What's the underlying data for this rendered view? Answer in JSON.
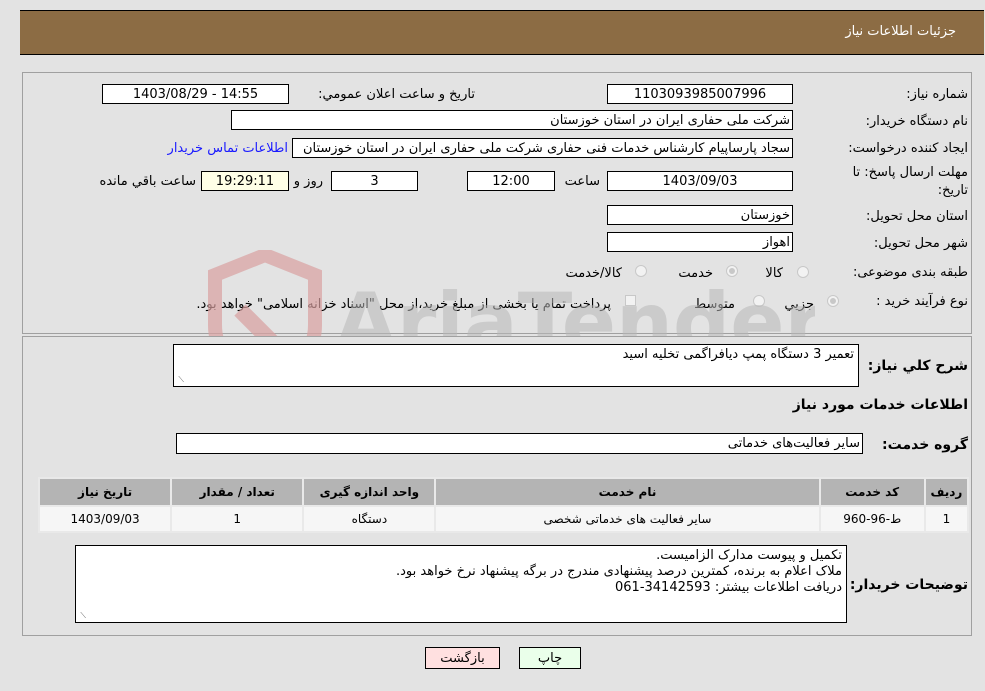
{
  "header": {
    "title": "جزئیات اطلاعات نیاز"
  },
  "form": {
    "need_number": {
      "label": "شماره نیاز:",
      "value": "1103093985007996"
    },
    "announce_datetime": {
      "label": "تاریخ و ساعت اعلان عمومي:",
      "value": "1403/08/29 - 14:55"
    },
    "buyer_org": {
      "label": "نام دستگاه خریدار:",
      "value": "شرکت ملی حفاری ایران در استان خوزستان"
    },
    "requester": {
      "label": "ایجاد کننده درخواست:",
      "value": "سجاد پارساپیام کارشناس خدمات فنی حفاری شرکت ملی حفاری ایران در استان خوزستان"
    },
    "buyer_contact_link": "اطلاعات تماس خریدار",
    "deadline": {
      "label_line1": "مهلت ارسال پاسخ: تا",
      "label_line2": "تاریخ:",
      "date": "1403/09/03",
      "time_label": "ساعت",
      "time": "12:00",
      "days": "3",
      "days_label": "روز و",
      "remaining": "19:29:11",
      "remaining_label": "ساعت باقي مانده"
    },
    "delivery_province": {
      "label": "استان محل تحویل:",
      "value": "خوزستان"
    },
    "delivery_city": {
      "label": "شهر محل تحویل:",
      "value": "اهواز"
    },
    "category": {
      "label": "طبقه بندی موضوعی:",
      "options": [
        "کالا",
        "خدمت",
        "کالا/خدمت"
      ],
      "selected": "خدمت"
    },
    "purchase_type": {
      "label": "نوع فرآیند خرید :",
      "options": [
        "جزيي",
        "متوسط"
      ],
      "selected": "جزيي",
      "payment_note": "پرداخت تمام یا بخشی از مبلغ خرید،از محل \"اسناد خزانه اسلامی\" خواهد بود."
    }
  },
  "details": {
    "description": {
      "label": "شرح کلي نياز:",
      "value": "تعمیر 3 دستگاه پمپ دیافراگمی تخلیه اسید"
    },
    "services_title": "اطلاعات خدمات مورد نياز",
    "service_group": {
      "label": "گروه خدمت:",
      "value": "سایر فعالیت‌های خدماتی"
    },
    "table": {
      "columns": [
        "ردیف",
        "کد خدمت",
        "نام خدمت",
        "واحد اندازه گیری",
        "تعداد / مقدار",
        "تاریخ نیاز"
      ],
      "rows": [
        [
          "1",
          "ط-96-960",
          "سایر فعالیت های خدماتی شخصی",
          "دستگاه",
          "1",
          "1403/09/03"
        ]
      ]
    },
    "buyer_notes": {
      "label": "توضیحات خریدار:",
      "lines": [
        "تکمیل و پیوست مدارک الزامیست.",
        "ملاک اعلام به برنده، کمترین درصد پیشنهادی مندرج در برگه پیشنهاد نرخ خواهد بود.",
        "دریافت اطلاعات بیشتر: 34142593-061"
      ]
    }
  },
  "buttons": {
    "print": "چاپ",
    "back": "بازگشت"
  },
  "watermark": {
    "text": "AriaTender.neT"
  },
  "colors": {
    "header_bg": "#8c6c44",
    "link": "#1a1aff",
    "back_bg": "#ffe0e0",
    "print_bg": "#eaffea",
    "remaining_bg": "#ffffe6"
  }
}
